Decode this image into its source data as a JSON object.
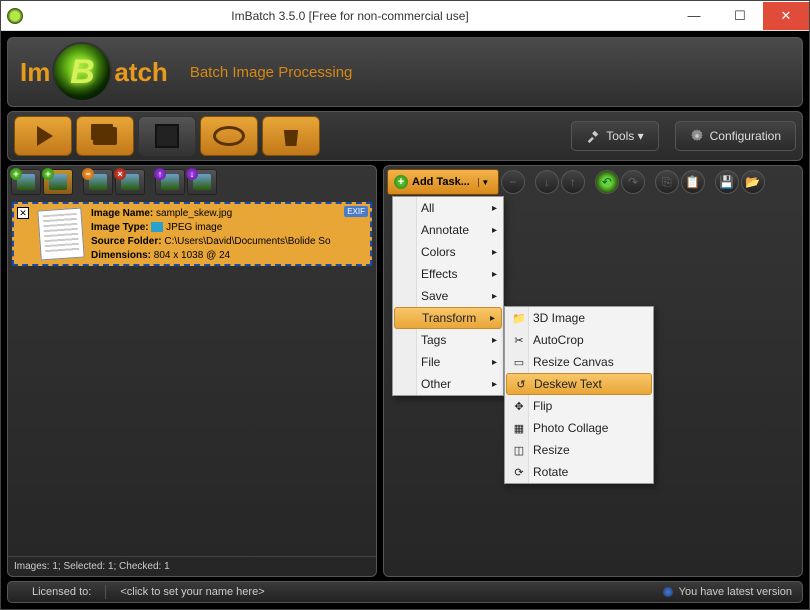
{
  "title": "ImBatch 3.5.0 [Free for non-commercial use]",
  "logo": {
    "left": "Im",
    "right": "atch",
    "subtitle": "Batch Image Processing"
  },
  "toolbar": {
    "tools": "Tools ▾",
    "config": "Configuration"
  },
  "image": {
    "name_label": "Image Name:",
    "name": "sample_skew.jpg",
    "type_label": "Image Type:",
    "type": "JPEG image",
    "folder_label": "Source Folder:",
    "folder": "C:\\Users\\David\\Documents\\Bolide So",
    "dim_label": "Dimensions:",
    "dim": "804 x 1038 @ 24",
    "exif": "EXIF",
    "status": "Images: 1; Selected: 1; Checked: 1"
  },
  "addtask": "Add Task...",
  "menu1": [
    "All",
    "Annotate",
    "Colors",
    "Effects",
    "Save",
    "Transform",
    "Tags",
    "File",
    "Other"
  ],
  "menu2": [
    {
      "icon": "📁",
      "label": "3D Image"
    },
    {
      "icon": "✂",
      "label": "AutoCrop"
    },
    {
      "icon": "▭",
      "label": "Resize Canvas"
    },
    {
      "icon": "↺",
      "label": "Deskew Text"
    },
    {
      "icon": "✥",
      "label": "Flip"
    },
    {
      "icon": "▦",
      "label": "Photo Collage"
    },
    {
      "icon": "◫",
      "label": "Resize"
    },
    {
      "icon": "⟳",
      "label": "Rotate"
    }
  ],
  "status": {
    "licensed": "Licensed to:",
    "hint": "<click to set your name here>",
    "version": "You have latest version"
  }
}
